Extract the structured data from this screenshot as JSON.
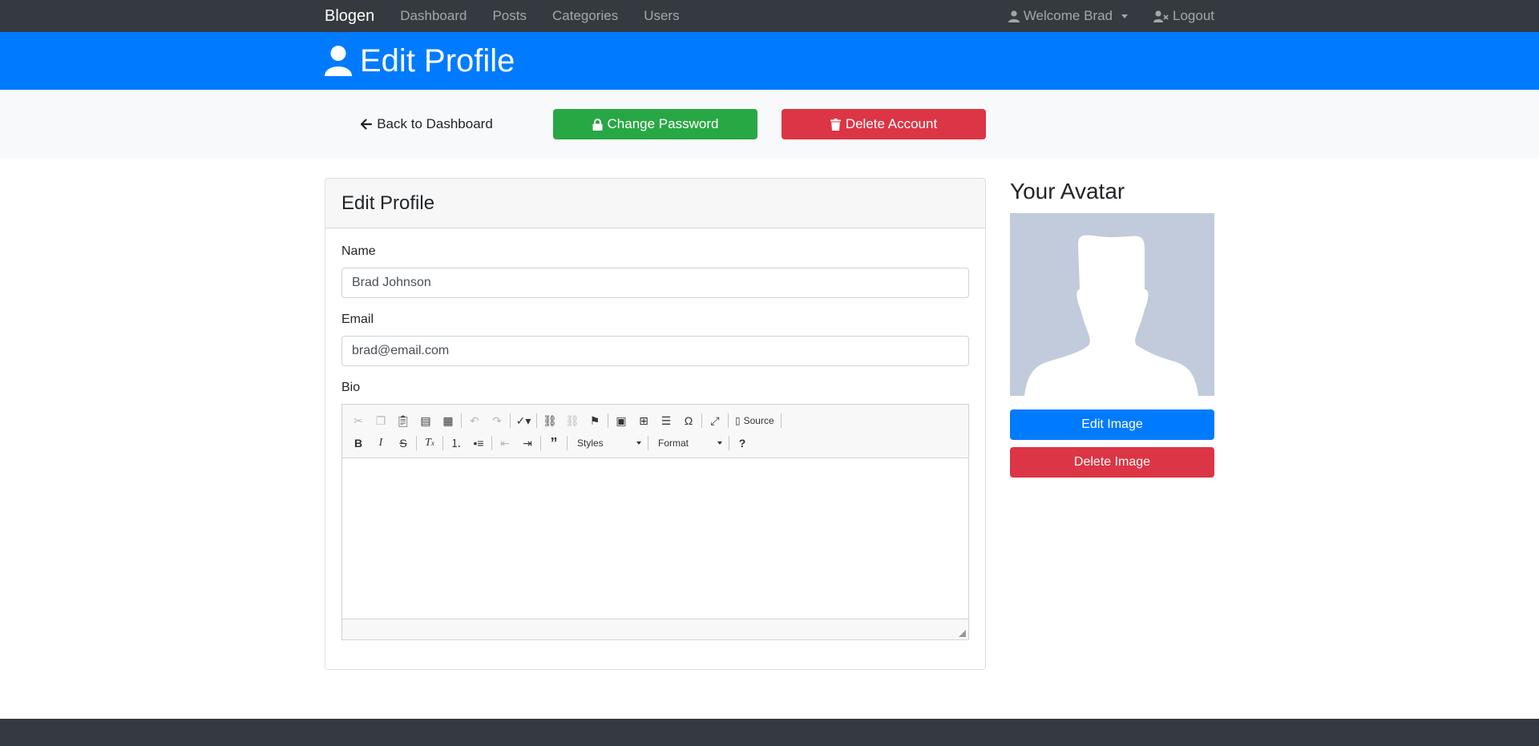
{
  "navbar": {
    "brand": "Blogen",
    "links": [
      "Dashboard",
      "Posts",
      "Categories",
      "Users"
    ],
    "welcome": "Welcome Brad",
    "logout": "Logout"
  },
  "header": {
    "title": "Edit Profile"
  },
  "actions": {
    "back": "Back to Dashboard",
    "change_password": "Change Password",
    "delete_account": "Delete Account"
  },
  "form": {
    "card_title": "Edit Profile",
    "name_label": "Name",
    "name_value": "Brad Johnson",
    "email_label": "Email",
    "email_value": "brad@email.com",
    "bio_label": "Bio",
    "toolbar": {
      "source_label": "Source",
      "styles_label": "Styles",
      "format_label": "Format"
    }
  },
  "avatar": {
    "title": "Your Avatar",
    "edit_button": "Edit Image",
    "delete_button": "Delete Image"
  },
  "colors": {
    "navbar": "#343a40",
    "primary": "#007bff",
    "success": "#28a745",
    "danger": "#dc3545",
    "avatar_bg": "#c1cbdb"
  }
}
